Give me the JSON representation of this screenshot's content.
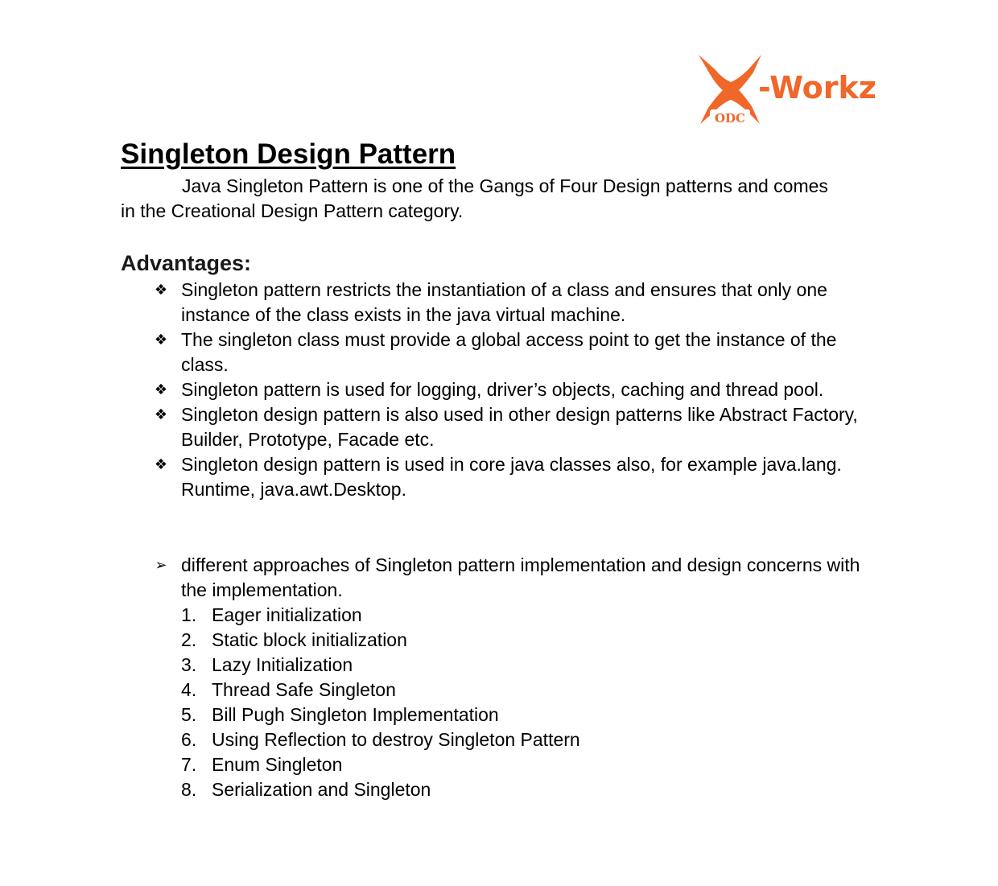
{
  "logo": {
    "wordmark": "-Workz",
    "badge": "ODC",
    "brand_color": "#f0672a"
  },
  "title": "Singleton Design Pattern",
  "intro": "Java Singleton Pattern is one of the Gangs of Four Design patterns and comes in the Creational Design Pattern category.",
  "advantages": {
    "heading": "Advantages:",
    "bullet_icon": "diamond-bullet-icon",
    "items": [
      "Singleton pattern restricts the instantiation of a class and ensures that only one instance of the class exists in the java virtual machine.",
      "The singleton class must provide a global access point to get the instance of the class.",
      "Singleton pattern is used for logging, driver’s objects, caching and thread pool.",
      "Singleton design pattern is also used in other design patterns like Abstract Factory, Builder, Prototype, Facade etc.",
      "Singleton design pattern is used in core java classes also, for example java.lang. Runtime, java.awt.Desktop."
    ]
  },
  "approaches": {
    "bullet_icon": "arrow-bullet-icon",
    "text": "different approaches of Singleton pattern implementation and design concerns with the implementation.",
    "items": [
      {
        "num": "1.",
        "label": "Eager initialization"
      },
      {
        "num": "2.",
        "label": "Static block initialization"
      },
      {
        "num": "3.",
        "label": "Lazy Initialization"
      },
      {
        "num": "4.",
        "label": "Thread Safe Singleton"
      },
      {
        "num": "5.",
        "label": "Bill Pugh Singleton Implementation"
      },
      {
        "num": "6.",
        "label": "Using Reflection to destroy Singleton Pattern"
      },
      {
        "num": "7.",
        "label": "Enum Singleton"
      },
      {
        "num": "8.",
        "label": "Serialization and Singleton"
      }
    ]
  }
}
